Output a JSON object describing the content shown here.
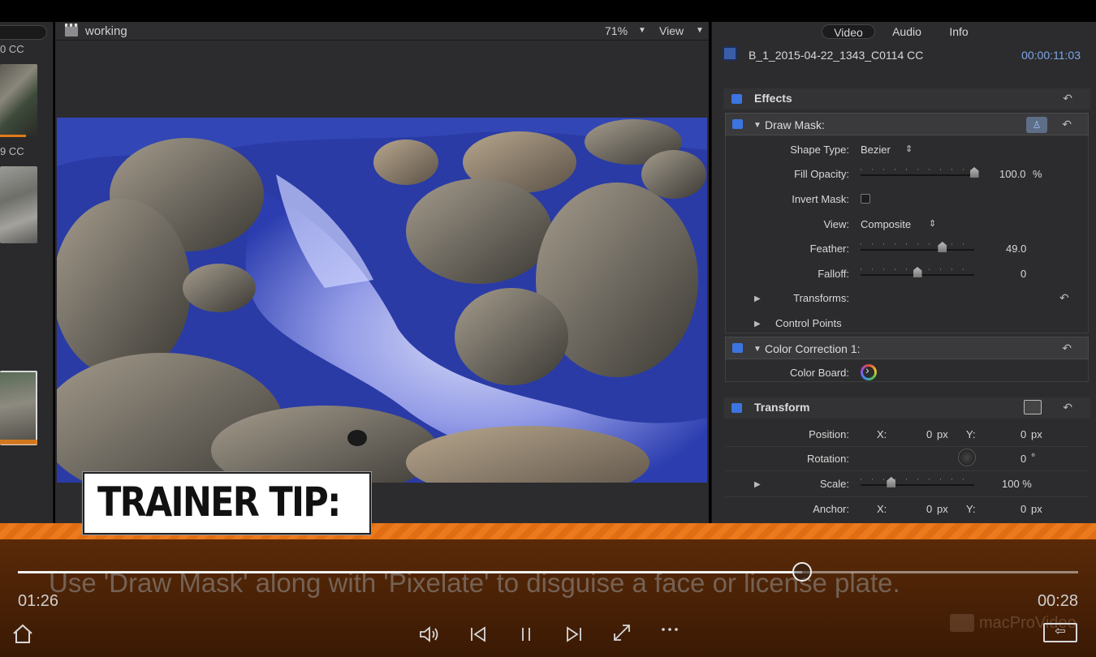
{
  "browser": {
    "clip_label_1": "0 CC",
    "clip_label_2": "9 CC"
  },
  "viewer": {
    "title": "working",
    "zoom": "71%",
    "view_menu": "View"
  },
  "inspector": {
    "tabs": [
      "Video",
      "Audio",
      "Info"
    ],
    "clip_name": "B_1_2015-04-22_1343_C0114 CC",
    "timecode": "00:00:11:03",
    "effects_header": "Effects",
    "draw_mask": {
      "title": "Draw Mask:",
      "shape_type_label": "Shape Type:",
      "shape_type_value": "Bezier",
      "fill_opacity_label": "Fill Opacity:",
      "fill_opacity_value": "100.0",
      "fill_opacity_unit": "%",
      "fill_opacity_level": 1.0,
      "invert_mask_label": "Invert Mask:",
      "invert_mask_checked": false,
      "view_label": "View:",
      "view_value": "Composite",
      "feather_label": "Feather:",
      "feather_value": "49.0",
      "feather_level": 0.72,
      "falloff_label": "Falloff:",
      "falloff_value": "0",
      "falloff_level": 0.5,
      "transforms_label": "Transforms:",
      "control_points_label": "Control Points"
    },
    "color_correction": {
      "title": "Color Correction 1:",
      "color_board_label": "Color Board:"
    },
    "transform": {
      "title": "Transform",
      "position_label": "Position:",
      "x_label": "X:",
      "y_label": "Y:",
      "position_x": "0",
      "position_y": "0",
      "px_unit": "px",
      "rotation_label": "Rotation:",
      "rotation_value": "0",
      "degree_unit": "°",
      "scale_label": "Scale:",
      "scale_value": "100 %",
      "scale_level": 0.27,
      "anchor_label": "Anchor:",
      "anchor_x": "0",
      "anchor_y": "0"
    }
  },
  "player": {
    "tip_title": "TRAINER TIP:",
    "tip_caption": "Use 'Draw Mask' along with 'Pixelate' to disguise a face or license plate.",
    "elapsed": "01:26",
    "remaining": "00:28",
    "progress": 0.74,
    "watermark": "macProVideo"
  },
  "icons": {
    "home": "home-icon",
    "volume": "volume-icon",
    "prev": "skip-back-icon",
    "pause": "pause-icon",
    "next": "skip-forward-icon",
    "fullscreen": "expand-icon",
    "more": "more-icon",
    "exit": "exit-fullscreen-icon"
  },
  "colors": {
    "accent_blue": "#3c74e0",
    "timecode_blue": "#7fa7e8",
    "orange_band": "#e06d14"
  }
}
